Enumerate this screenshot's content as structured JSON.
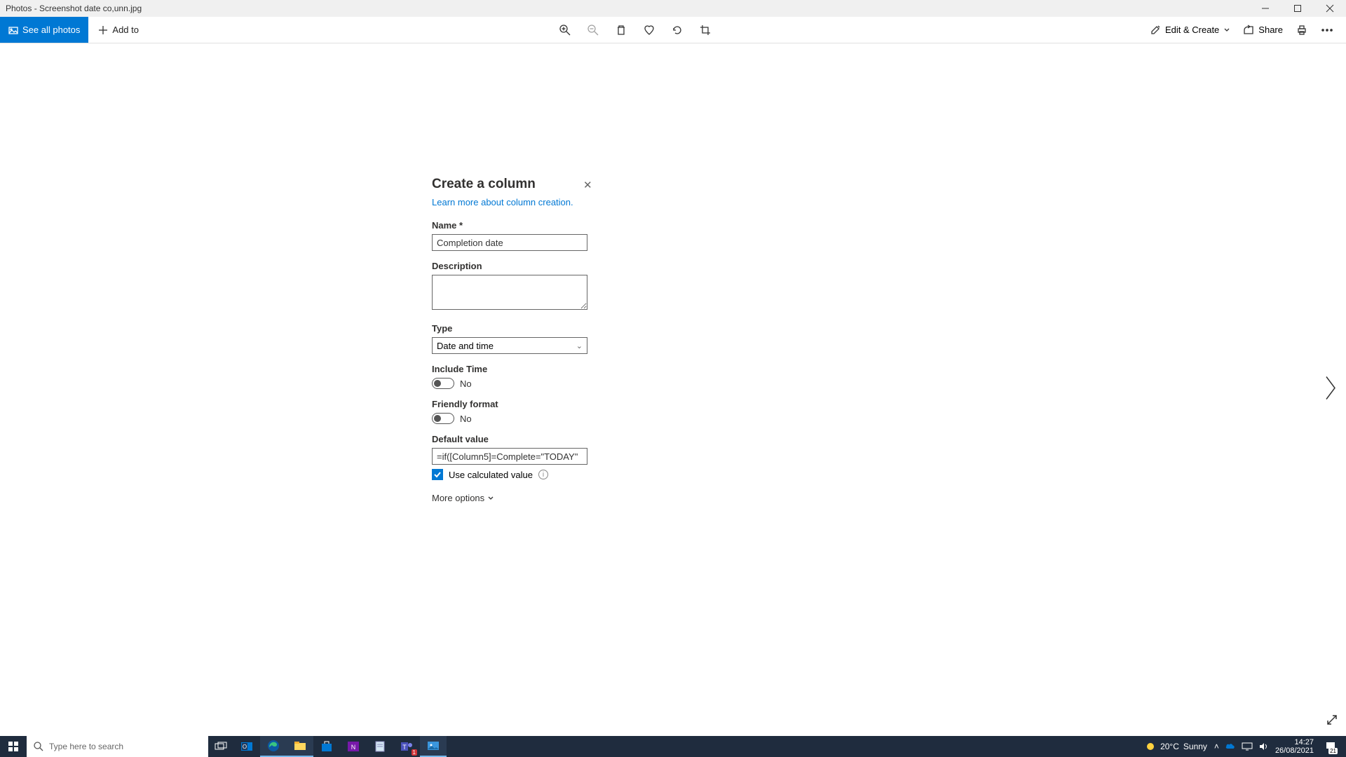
{
  "window": {
    "title": "Photos - Screenshot date co,unn.jpg"
  },
  "toolbar": {
    "see_all": "See all photos",
    "add_to": "Add to",
    "edit_create": "Edit & Create",
    "share": "Share"
  },
  "panel": {
    "title": "Create a column",
    "learn_more": "Learn more about column creation.",
    "name_label": "Name *",
    "name_value": "Completion date",
    "desc_label": "Description",
    "desc_value": "",
    "type_label": "Type",
    "type_value": "Date and time",
    "include_time_label": "Include Time",
    "include_time_value": "No",
    "friendly_label": "Friendly format",
    "friendly_value": "No",
    "default_label": "Default value",
    "default_value": "=if([Column5]=Complete=\"TODAY\"",
    "use_calc": "Use calculated value",
    "more_options": "More options"
  },
  "taskbar": {
    "search_placeholder": "Type here to search",
    "weather_temp": "20°C",
    "weather_cond": "Sunny",
    "time": "14:27",
    "date": "26/08/2021",
    "action_badge": "21"
  }
}
